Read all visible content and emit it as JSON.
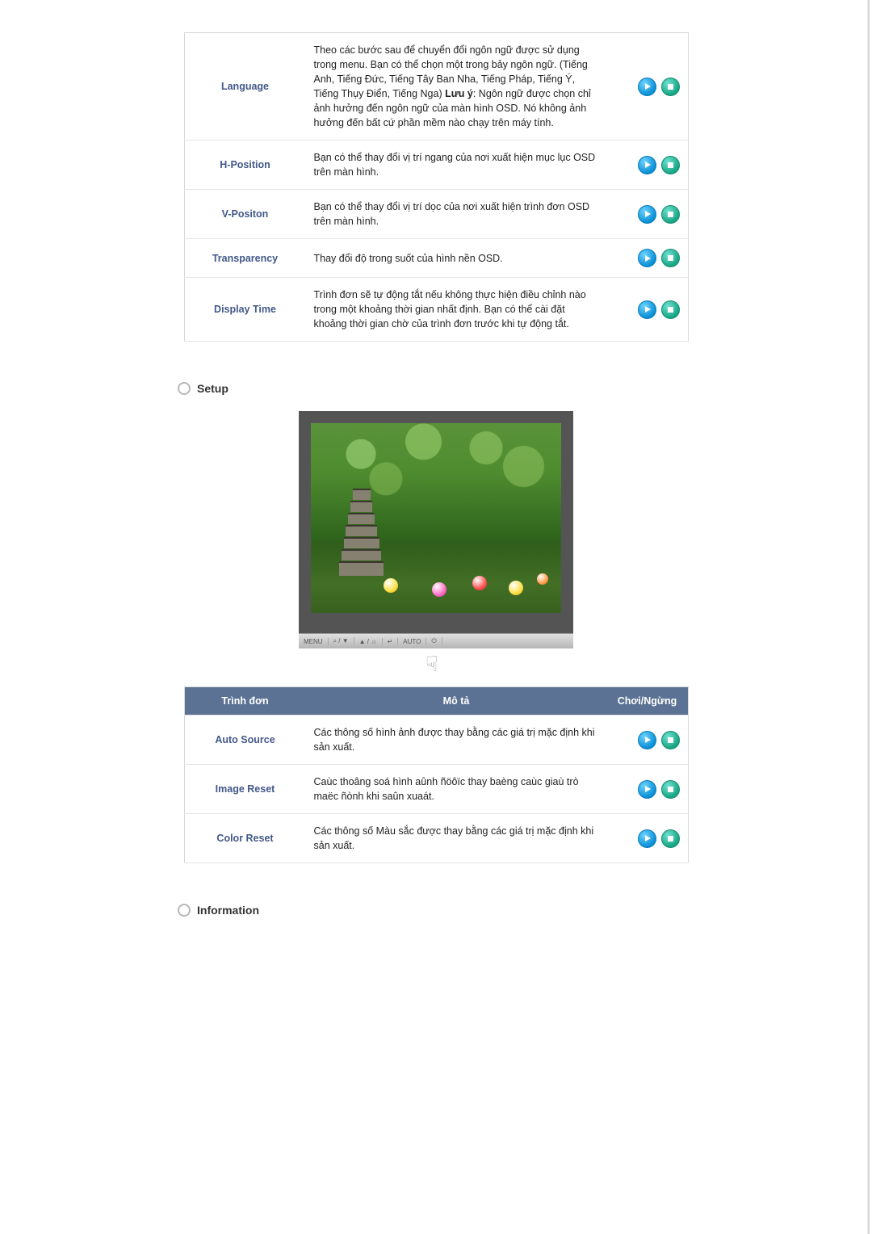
{
  "table1": {
    "rows": [
      {
        "label": "Language",
        "desc_a": "Theo các bước sau để chuyển đổi ngôn ngữ được sử dụng trong menu. Bạn có thể chọn một trong bảy ngôn ngữ. (Tiếng Anh, Tiếng Đức, Tiếng Tây Ban Nha, Tiếng Pháp, Tiếng Ý, Tiếng Thụy Điển, Tiếng Nga) ",
        "bold": "Lưu ý",
        "desc_b": ": Ngôn ngữ được chọn chỉ ảnh hưởng đến ngôn ngữ của màn hình OSD. Nó không ảnh hưởng đến bất cứ phần mềm nào chạy trên máy tính."
      },
      {
        "label": "H-Position",
        "desc": "Bạn có thể thay đổi vị trí ngang của nơi xuất hiện mục lục OSD trên màn hình."
      },
      {
        "label": "V-Positon",
        "desc": "Bạn có thể thay đổi vị trí dọc của nơi xuất hiện trình đơn OSD trên màn hình."
      },
      {
        "label": "Transparency",
        "desc": "Thay đổi độ trong suốt của hình nền OSD."
      },
      {
        "label": "Display Time",
        "desc": "Trình đơn sẽ tự động tắt nếu không thực hiện điều chỉnh nào trong một khoảng thời gian nhất định. Bạn có thể cài đặt khoảng thời gian chờ của trình đơn trước khi tự động tắt."
      }
    ]
  },
  "sections": {
    "setup": "Setup",
    "information": "Information"
  },
  "menubar": {
    "menu": "MENU",
    "bc": "⌕ / ▼",
    "up": "▲ / ☼",
    "enter": "↵",
    "auto": "AUTO",
    "power": "⏻"
  },
  "table2": {
    "headers": {
      "menu": "Trình đơn",
      "desc": "Mô tả",
      "play": "Chơi/Ngừng"
    },
    "rows": [
      {
        "label": "Auto Source",
        "desc": "Các thông số hình ảnh được thay bằng các giá trị mặc định khi sản xuất."
      },
      {
        "label": "Image Reset",
        "desc": "Caùc thoâng soá hình aûnh ñöôïc thay baèng caùc giaù trò maëc ñònh khi saûn xuaát."
      },
      {
        "label": "Color Reset",
        "desc": "Các thông số Màu sắc được thay bằng các giá trị mặc định khi sản xuất."
      }
    ]
  }
}
